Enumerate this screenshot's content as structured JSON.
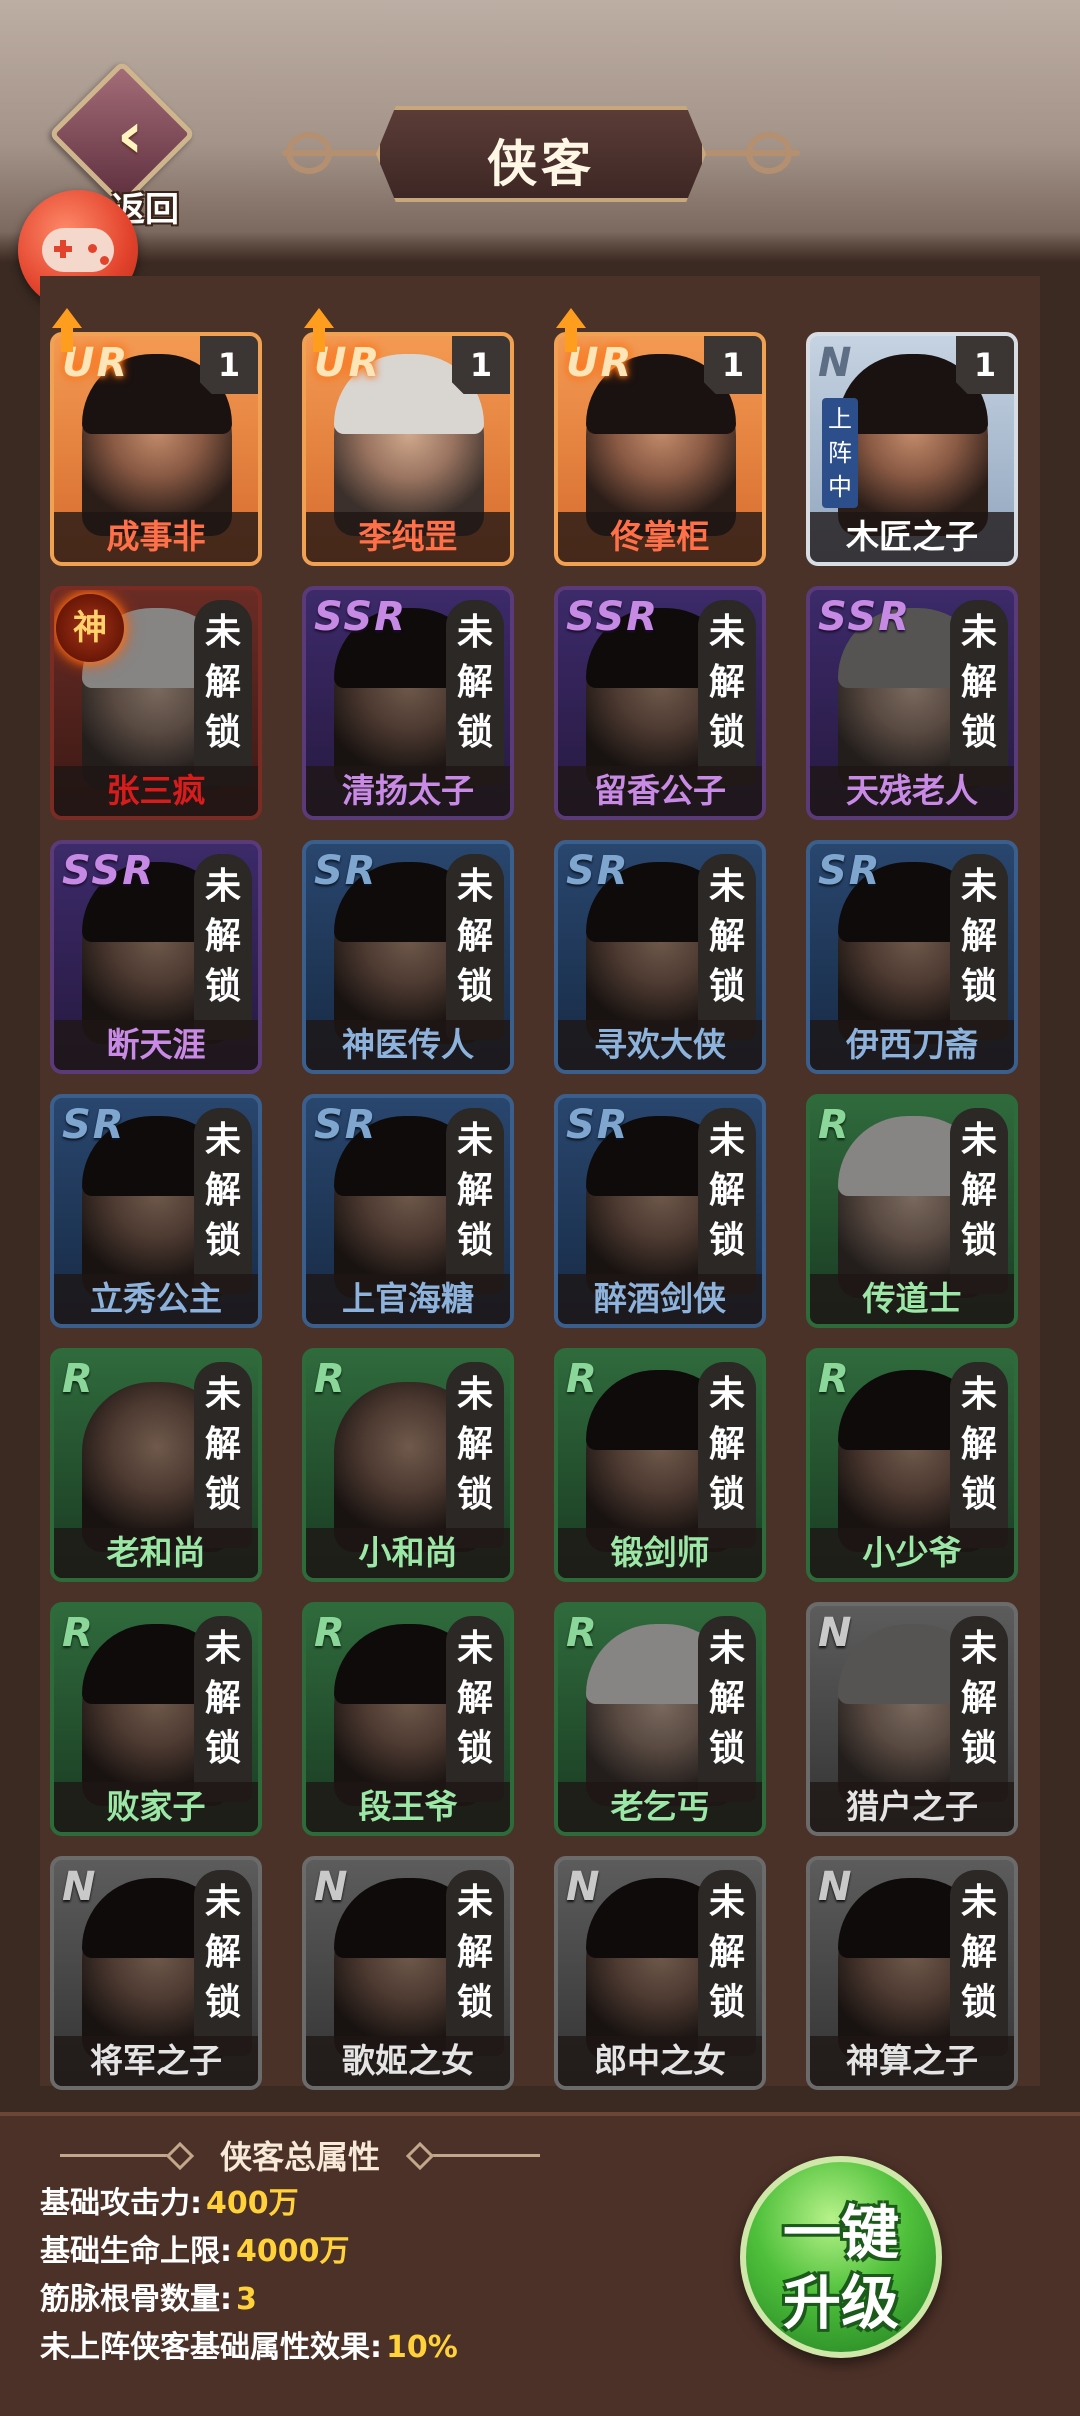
{
  "header": {
    "title": "侠客",
    "back_label": "返回"
  },
  "heroes": [
    {
      "name": "成事非",
      "rarity": "UR",
      "level": "1",
      "unlocked": true,
      "upgradable": true
    },
    {
      "name": "李纯罡",
      "rarity": "UR",
      "level": "1",
      "unlocked": true,
      "upgradable": true
    },
    {
      "name": "佟掌柜",
      "rarity": "UR",
      "level": "1",
      "unlocked": true,
      "upgradable": true
    },
    {
      "name": "木匠之子",
      "rarity": "N",
      "level": "1",
      "unlocked": true,
      "deployed_label": "上阵中"
    },
    {
      "name": "张三疯",
      "rarity": "神",
      "unlocked": false
    },
    {
      "name": "清扬太子",
      "rarity": "SSR",
      "unlocked": false
    },
    {
      "name": "留香公子",
      "rarity": "SSR",
      "unlocked": false
    },
    {
      "name": "天残老人",
      "rarity": "SSR",
      "unlocked": false
    },
    {
      "name": "断天涯",
      "rarity": "SSR",
      "unlocked": false
    },
    {
      "name": "神医传人",
      "rarity": "SR",
      "unlocked": false
    },
    {
      "name": "寻欢大侠",
      "rarity": "SR",
      "unlocked": false
    },
    {
      "name": "伊西刀斋",
      "rarity": "SR",
      "unlocked": false
    },
    {
      "name": "立秀公主",
      "rarity": "SR",
      "unlocked": false
    },
    {
      "name": "上官海糖",
      "rarity": "SR",
      "unlocked": false
    },
    {
      "name": "醉酒剑侠",
      "rarity": "SR",
      "unlocked": false
    },
    {
      "name": "传道士",
      "rarity": "R",
      "unlocked": false
    },
    {
      "name": "老和尚",
      "rarity": "R",
      "unlocked": false
    },
    {
      "name": "小和尚",
      "rarity": "R",
      "unlocked": false
    },
    {
      "name": "锻剑师",
      "rarity": "R",
      "unlocked": false
    },
    {
      "name": "小少爷",
      "rarity": "R",
      "unlocked": false
    },
    {
      "name": "败家子",
      "rarity": "R",
      "unlocked": false
    },
    {
      "name": "段王爷",
      "rarity": "R",
      "unlocked": false
    },
    {
      "name": "老乞丐",
      "rarity": "R",
      "unlocked": false
    },
    {
      "name": "猎户之子",
      "rarity": "N",
      "unlocked": false
    },
    {
      "name": "将军之子",
      "rarity": "N",
      "unlocked": false
    },
    {
      "name": "歌姬之女",
      "rarity": "N",
      "unlocked": false
    },
    {
      "name": "郎中之女",
      "rarity": "N",
      "unlocked": false
    },
    {
      "name": "神算之子",
      "rarity": "N",
      "unlocked": false
    }
  ],
  "locked_label": "未解锁",
  "stats": {
    "title": "侠客总属性",
    "rows": [
      {
        "label": "基础攻击力:",
        "value": "400万"
      },
      {
        "label": "基础生命上限:",
        "value": "4000万"
      },
      {
        "label": "筋脉根骨数量:",
        "value": "3"
      },
      {
        "label": "未上阵侠客基础属性效果:",
        "value": "10%"
      }
    ]
  },
  "upgrade_button": {
    "line1": "一键",
    "line2": "升级"
  },
  "colors": {
    "ur_name": "#ff7049",
    "god_name": "#d81c1c",
    "ssr_name": "#c98ae6",
    "sr_name": "#8db3dc",
    "r_name": "#9be7a5",
    "stat_value": "#ffd23a",
    "upgrade_green": "#4fc03b"
  }
}
